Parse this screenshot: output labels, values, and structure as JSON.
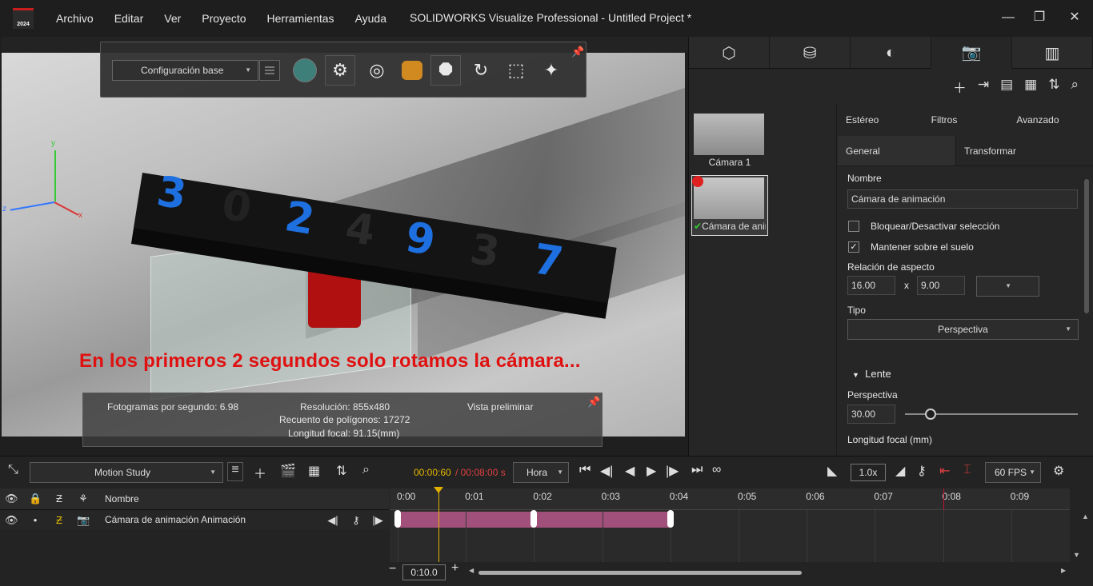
{
  "menubar": {
    "logo_year": "2024",
    "items": [
      "Archivo",
      "Editar",
      "Ver",
      "Proyecto",
      "Herramientas",
      "Ayuda"
    ],
    "title": "SOLIDWORKS Visualize Professional - Untitled Project *"
  },
  "viewport": {
    "toolbar": {
      "config_value": "Configuración base"
    },
    "caption": "En los primeros 2 segundos solo rotamos la cámara...",
    "axes": {
      "x": "x",
      "y": "y",
      "z": "z"
    },
    "stats": {
      "fps": "Fotogramas por segundo: 6.98",
      "resolution": "Resolución: 855x480",
      "polygons": "Recuento de polígonos: 17272",
      "focal": "Longitud focal: 91.15(mm)",
      "mode": "Vista preliminar"
    }
  },
  "right_panel": {
    "thumbs": [
      {
        "label": "Cámara 1"
      },
      {
        "label": "Cámara de animación"
      }
    ],
    "subtabs_top": [
      "Estéreo",
      "Filtros",
      "Avanzado"
    ],
    "subtabs": [
      "General",
      "Transformar"
    ],
    "form": {
      "name_label": "Nombre",
      "name_value": "Cámara de animación",
      "lock_label": "Bloquear/Desactivar selección",
      "lock_checked": false,
      "ground_label": "Mantener sobre el suelo",
      "ground_checked": true,
      "aspect_label": "Relación de aspecto",
      "aspect_w": "16.00",
      "aspect_x": "x",
      "aspect_h": "9.00",
      "type_label": "Tipo",
      "type_value": "Perspectiva",
      "lens_section": "Lente",
      "persp_label": "Perspectiva",
      "persp_value": "30.00",
      "focal_label": "Longitud focal (mm)"
    }
  },
  "bottom": {
    "study_select": "Motion Study",
    "time_current": "00:00:60",
    "time_total": " / 00:08:00 s",
    "time_unit": "Hora",
    "speed": "1.0x",
    "fps": "60 FPS",
    "track_header": "Nombre",
    "track_name": "Cámara de animación Animación",
    "ruler": [
      "0:00",
      "0:01",
      "0:02",
      "0:03",
      "0:04",
      "0:05",
      "0:06",
      "0:07",
      "0:08",
      "0:09"
    ],
    "zoom": "0:10.0",
    "playhead_time": 0.6,
    "end_time": 8.0,
    "keyframes": [
      0,
      2,
      4
    ]
  },
  "colors": {
    "accent_red": "#e01010",
    "clip": "#a0507a",
    "playhead": "#e0b000"
  }
}
